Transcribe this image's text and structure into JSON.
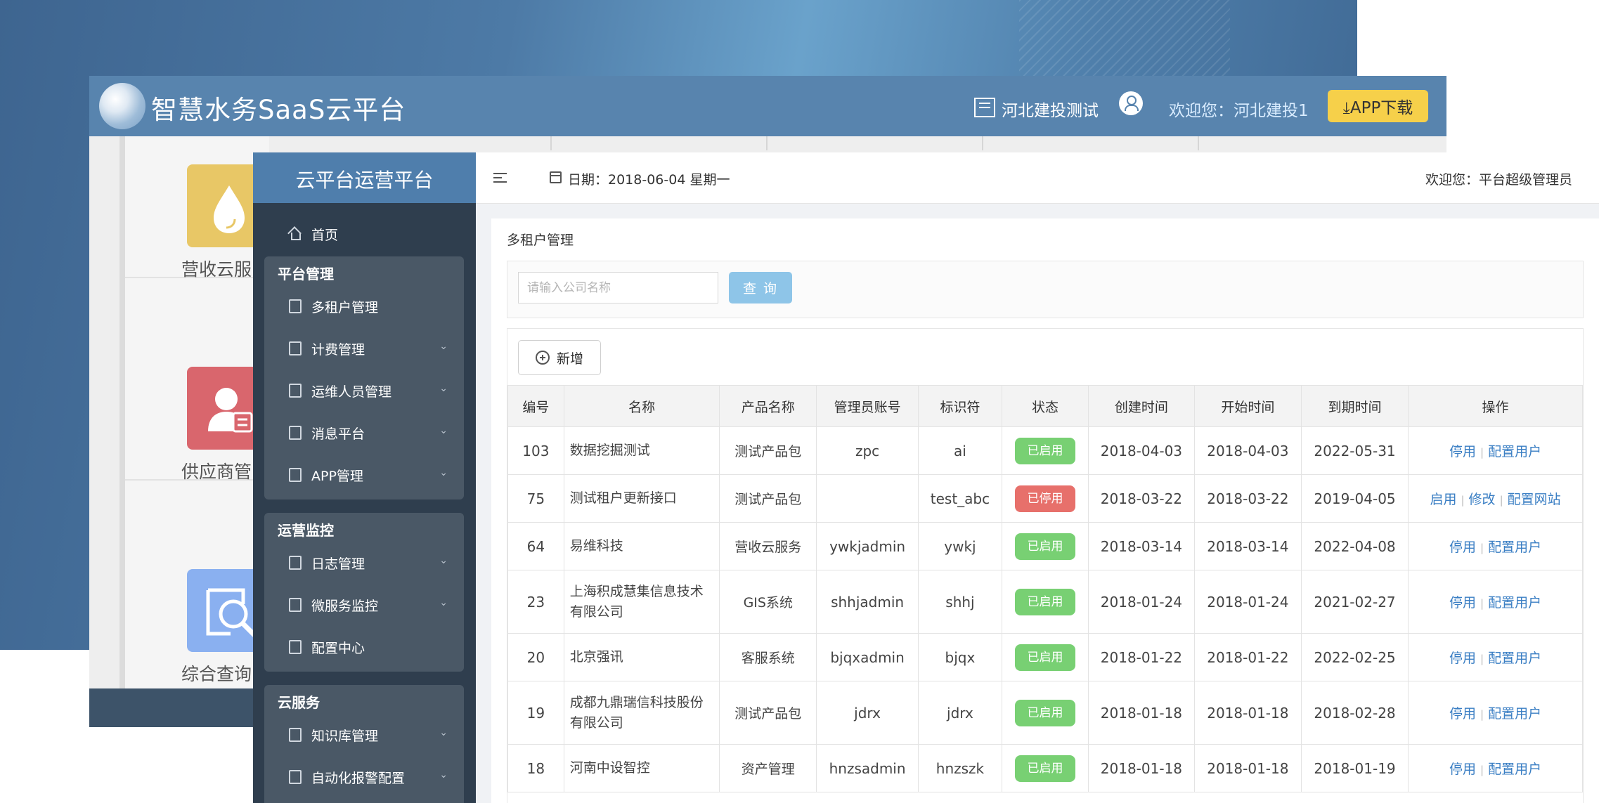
{
  "back_app": {
    "title": "智慧水务SaaS云平台",
    "company": "河北建投测试",
    "welcome": "欢迎您：河北建投1",
    "app_download": "⤓APP下载",
    "tiles": [
      {
        "label": "营收云服",
        "color": "#e8c766"
      },
      {
        "label": "供应商管",
        "color": "#d9666d"
      },
      {
        "label": "综合查询",
        "color": "#8ab0f0"
      }
    ]
  },
  "front_app": {
    "sidebar": {
      "title": "云平台运营平台",
      "home": "首页",
      "groups": [
        {
          "title": "平台管理",
          "items": [
            {
              "label": "多租户管理",
              "icon": "tenant-icon",
              "has_chevron": false
            },
            {
              "label": "计费管理",
              "icon": "billing-icon",
              "has_chevron": true
            },
            {
              "label": "运维人员管理",
              "icon": "staff-icon",
              "has_chevron": true
            },
            {
              "label": "消息平台",
              "icon": "message-icon",
              "has_chevron": true
            },
            {
              "label": "APP管理",
              "icon": "app-icon",
              "has_chevron": true
            }
          ]
        },
        {
          "title": "运营监控",
          "items": [
            {
              "label": "日志管理",
              "icon": "log-icon",
              "has_chevron": true
            },
            {
              "label": "微服务监控",
              "icon": "monitor-icon",
              "has_chevron": true
            },
            {
              "label": "配置中心",
              "icon": "config-icon",
              "has_chevron": false
            }
          ]
        },
        {
          "title": "云服务",
          "items": [
            {
              "label": "知识库管理",
              "icon": "knowledge-icon",
              "has_chevron": true
            },
            {
              "label": "自动化报警配置",
              "icon": "alarm-icon",
              "has_chevron": true
            }
          ]
        }
      ],
      "chevron": "⌄"
    },
    "topbar": {
      "date": "日期：2018-06-04 星期一",
      "welcome": "欢迎您：平台超级管理员"
    },
    "breadcrumb": "多租户管理",
    "search": {
      "placeholder": "请输入公司名称",
      "value": "",
      "button": "查 询"
    },
    "add_button": "新增",
    "table": {
      "columns": [
        "编号",
        "名称",
        "产品名称",
        "管理员账号",
        "标识符",
        "状态",
        "创建时间",
        "开始时间",
        "到期时间",
        "操作"
      ],
      "rows": [
        {
          "id": "103",
          "name": "数据挖掘测试",
          "product": "测试产品包",
          "admin": "zpc",
          "code": "ai",
          "status": "已启用",
          "status_on": true,
          "created": "2018-04-03",
          "start": "2018-04-03",
          "end": "2022-05-31",
          "ops": [
            "停用",
            "配置用户"
          ]
        },
        {
          "id": "75",
          "name": "测试租户更新接口",
          "product": "测试产品包",
          "admin": "",
          "code": "test_abc",
          "status": "已停用",
          "status_on": false,
          "created": "2018-03-22",
          "start": "2018-03-22",
          "end": "2019-04-05",
          "ops": [
            "启用",
            "修改",
            "配置网站"
          ]
        },
        {
          "id": "64",
          "name": "易维科技",
          "product": "营收云服务",
          "admin": "ywkjadmin",
          "code": "ywkj",
          "status": "已启用",
          "status_on": true,
          "created": "2018-03-14",
          "start": "2018-03-14",
          "end": "2022-04-08",
          "ops": [
            "停用",
            "配置用户"
          ]
        },
        {
          "id": "23",
          "name": "上海积成慧集信息技术有限公司",
          "product": "GIS系统",
          "admin": "shhjadmin",
          "code": "shhj",
          "status": "已启用",
          "status_on": true,
          "created": "2018-01-24",
          "start": "2018-01-24",
          "end": "2021-02-27",
          "ops": [
            "停用",
            "配置用户"
          ]
        },
        {
          "id": "20",
          "name": "北京强讯",
          "product": "客服系统",
          "admin": "bjqxadmin",
          "code": "bjqx",
          "status": "已启用",
          "status_on": true,
          "created": "2018-01-22",
          "start": "2018-01-22",
          "end": "2022-02-25",
          "ops": [
            "停用",
            "配置用户"
          ]
        },
        {
          "id": "19",
          "name": "成都九鼎瑞信科技股份有限公司",
          "product": "测试产品包",
          "admin": "jdrx",
          "code": "jdrx",
          "status": "已启用",
          "status_on": true,
          "created": "2018-01-18",
          "start": "2018-01-18",
          "end": "2018-02-28",
          "ops": [
            "停用",
            "配置用户"
          ]
        },
        {
          "id": "18",
          "name": "河南中设智控",
          "product": "资产管理",
          "admin": "hnzsadmin",
          "code": "hnzszk",
          "status": "已启用",
          "status_on": true,
          "created": "2018-01-18",
          "start": "2018-01-18",
          "end": "2018-01-19",
          "ops": [
            "停用",
            "配置用户"
          ]
        }
      ]
    }
  }
}
